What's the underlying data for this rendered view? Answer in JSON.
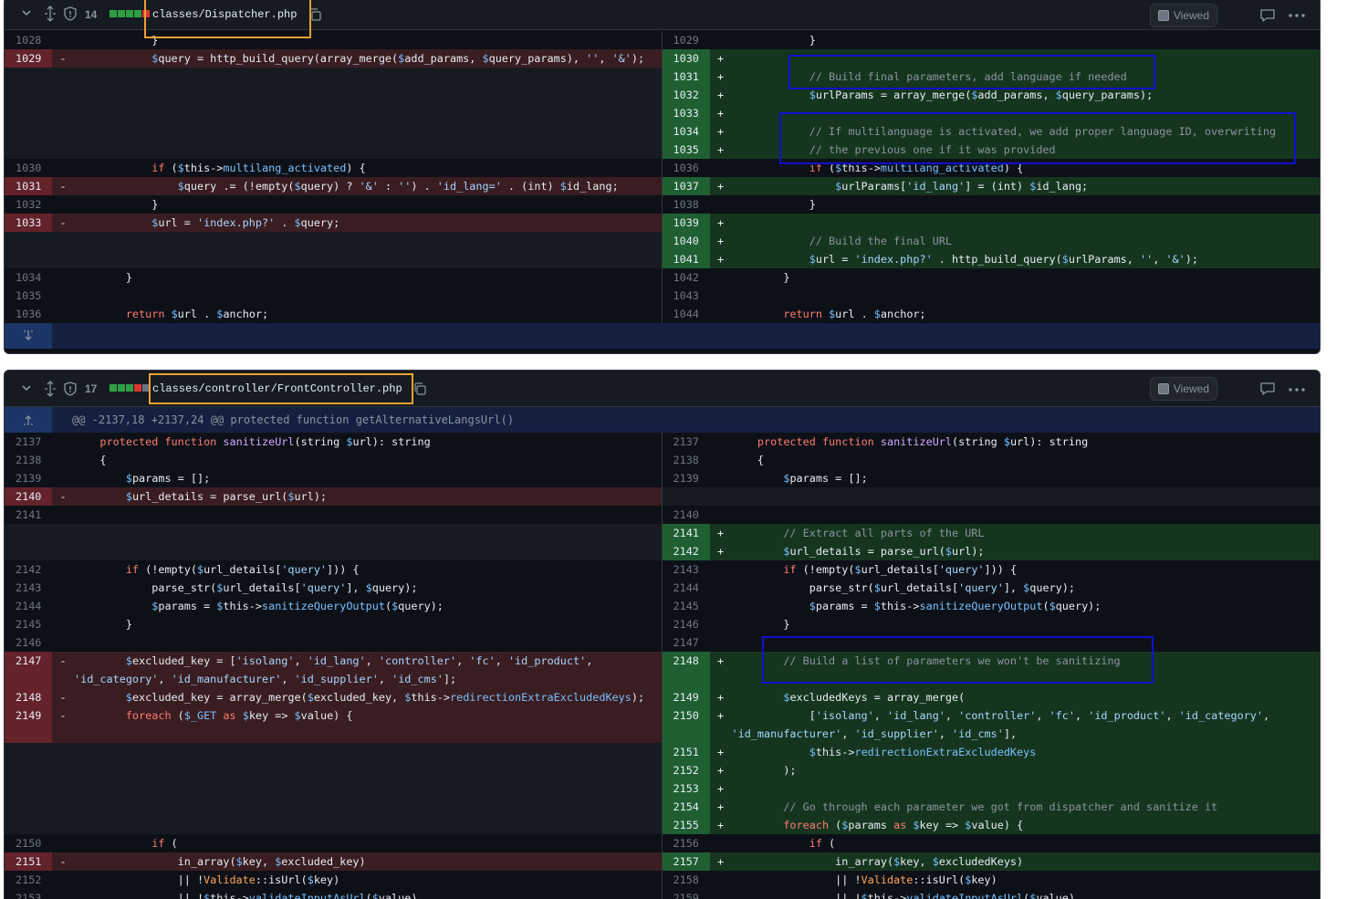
{
  "files": [
    {
      "name": "classes/Dispatcher.php",
      "changes": "14",
      "viewed_label": "Viewed",
      "stat_colors": [
        "#2ea043",
        "#2ea043",
        "#2ea043",
        "#2ea043",
        "#da3633",
        "#6e7681"
      ]
    },
    {
      "name": "classes/controller/FrontController.php",
      "changes": "17",
      "viewed_label": "Viewed",
      "hunk": "@@ -2137,18 +2137,24 @@ protected function getAlternativeLangsUrl()",
      "stat_colors": [
        "#2ea043",
        "#2ea043",
        "#2ea043",
        "#da3633",
        "#da3633",
        "#6e7681"
      ]
    }
  ],
  "diff1": [
    {
      "l": {
        "n": "1028",
        "k": "ctx",
        "c": "            }"
      },
      "r": {
        "n": "1029",
        "k": "ctx",
        "c": "            }"
      }
    },
    {
      "l": {
        "n": "1029",
        "k": "del",
        "c": "            $query = http_build_query(array_merge($add_params, $query_params), '', '&');"
      },
      "r": {
        "n": "1030",
        "k": "add",
        "c": ""
      }
    },
    {
      "l": {
        "k": "empty"
      },
      "r": {
        "n": "1031",
        "k": "add",
        "c": "            // Build final parameters, add language if needed"
      }
    },
    {
      "l": {
        "k": "empty"
      },
      "r": {
        "n": "1032",
        "k": "add",
        "c": "            $urlParams = array_merge($add_params, $query_params);"
      }
    },
    {
      "l": {
        "k": "empty"
      },
      "r": {
        "n": "1033",
        "k": "add",
        "c": ""
      }
    },
    {
      "l": {
        "k": "empty"
      },
      "r": {
        "n": "1034",
        "k": "add",
        "c": "            // If multilanguage is activated, we add proper language ID, overwriting"
      }
    },
    {
      "l": {
        "k": "empty"
      },
      "r": {
        "n": "1035",
        "k": "add",
        "c": "            // the previous one if it was provided"
      }
    },
    {
      "l": {
        "n": "1030",
        "k": "ctx",
        "c": "            if ($this->multilang_activated) {"
      },
      "r": {
        "n": "1036",
        "k": "ctx",
        "c": "            if ($this->multilang_activated) {"
      }
    },
    {
      "l": {
        "n": "1031",
        "k": "del",
        "c": "                $query .= (!empty($query) ? '&' : '') . 'id_lang=' . (int) $id_lang;"
      },
      "r": {
        "n": "1037",
        "k": "add",
        "c": "                $urlParams['id_lang'] = (int) $id_lang;"
      }
    },
    {
      "l": {
        "n": "1032",
        "k": "ctx",
        "c": "            }"
      },
      "r": {
        "n": "1038",
        "k": "ctx",
        "c": "            }"
      }
    },
    {
      "l": {
        "n": "1033",
        "k": "del",
        "c": "            $url = 'index.php?' . $query;"
      },
      "r": {
        "n": "1039",
        "k": "add",
        "c": ""
      }
    },
    {
      "l": {
        "k": "empty"
      },
      "r": {
        "n": "1040",
        "k": "add",
        "c": "            // Build the final URL"
      }
    },
    {
      "l": {
        "k": "empty"
      },
      "r": {
        "n": "1041",
        "k": "add",
        "c": "            $url = 'index.php?' . http_build_query($urlParams, '', '&');"
      }
    },
    {
      "l": {
        "n": "1034",
        "k": "ctx",
        "c": "        }"
      },
      "r": {
        "n": "1042",
        "k": "ctx",
        "c": "        }"
      }
    },
    {
      "l": {
        "n": "1035",
        "k": "ctx",
        "c": ""
      },
      "r": {
        "n": "1043",
        "k": "ctx",
        "c": ""
      }
    },
    {
      "l": {
        "n": "1036",
        "k": "ctx",
        "c": "        return $url . $anchor;"
      },
      "r": {
        "n": "1044",
        "k": "ctx",
        "c": "        return $url . $anchor;"
      }
    }
  ],
  "diff2": [
    {
      "l": {
        "n": "2137",
        "k": "ctx",
        "c": "    protected function sanitizeUrl(string $url): string"
      },
      "r": {
        "n": "2137",
        "k": "ctx",
        "c": "    protected function sanitizeUrl(string $url): string"
      }
    },
    {
      "l": {
        "n": "2138",
        "k": "ctx",
        "c": "    {"
      },
      "r": {
        "n": "2138",
        "k": "ctx",
        "c": "    {"
      }
    },
    {
      "l": {
        "n": "2139",
        "k": "ctx",
        "c": "        $params = [];"
      },
      "r": {
        "n": "2139",
        "k": "ctx",
        "c": "        $params = [];"
      }
    },
    {
      "l": {
        "n": "2140",
        "k": "del",
        "c": "        $url_details = parse_url($url);"
      },
      "r": {
        "k": "empty"
      }
    },
    {
      "l": {
        "n": "2141",
        "k": "ctx",
        "c": ""
      },
      "r": {
        "n": "2140",
        "k": "ctx",
        "c": ""
      }
    },
    {
      "l": {
        "k": "empty"
      },
      "r": {
        "n": "2141",
        "k": "add",
        "c": "        // Extract all parts of the URL"
      }
    },
    {
      "l": {
        "k": "empty"
      },
      "r": {
        "n": "2142",
        "k": "add",
        "c": "        $url_details = parse_url($url);"
      }
    },
    {
      "l": {
        "n": "2142",
        "k": "ctx",
        "c": "        if (!empty($url_details['query'])) {"
      },
      "r": {
        "n": "2143",
        "k": "ctx",
        "c": "        if (!empty($url_details['query'])) {"
      }
    },
    {
      "l": {
        "n": "2143",
        "k": "ctx",
        "c": "            parse_str($url_details['query'], $query);"
      },
      "r": {
        "n": "2144",
        "k": "ctx",
        "c": "            parse_str($url_details['query'], $query);"
      }
    },
    {
      "l": {
        "n": "2144",
        "k": "ctx",
        "c": "            $params = $this->sanitizeQueryOutput($query);"
      },
      "r": {
        "n": "2145",
        "k": "ctx",
        "c": "            $params = $this->sanitizeQueryOutput($query);"
      }
    },
    {
      "l": {
        "n": "2145",
        "k": "ctx",
        "c": "        }"
      },
      "r": {
        "n": "2146",
        "k": "ctx",
        "c": "        }"
      }
    },
    {
      "l": {
        "n": "2146",
        "k": "ctx",
        "c": ""
      },
      "r": {
        "n": "2147",
        "k": "ctx",
        "c": ""
      }
    },
    {
      "l": {
        "n": "2147",
        "k": "del",
        "c": "        $excluded_key = ['isolang', 'id_lang', 'controller', 'fc', 'id_product',"
      },
      "r": {
        "n": "2148",
        "k": "add",
        "c": "        // Build a list of parameters we won't be sanitizing"
      }
    },
    {
      "l": {
        "k": "del",
        "c": "'id_category', 'id_manufacturer', 'id_supplier', 'id_cms'];"
      },
      "r": {
        "k": "add",
        "c": ""
      }
    },
    {
      "l": {
        "n": "2148",
        "k": "del",
        "c": "        $excluded_key = array_merge($excluded_key, $this->redirectionExtraExcludedKeys);"
      },
      "r": {
        "n": "2149",
        "k": "add",
        "c": "        $excludedKeys = array_merge("
      }
    },
    {
      "l": {
        "n": "2149",
        "k": "del",
        "c": "        foreach ($_GET as $key => $value) {"
      },
      "r": {
        "n": "2150",
        "k": "add",
        "c": "            ['isolang', 'id_lang', 'controller', 'fc', 'id_product', 'id_category',"
      }
    },
    {
      "l": {
        "k": "del",
        "c": ""
      },
      "r": {
        "k": "add",
        "c": "'id_manufacturer', 'id_supplier', 'id_cms'],"
      }
    },
    {
      "l": {
        "k": "empty"
      },
      "r": {
        "n": "2151",
        "k": "add",
        "c": "            $this->redirectionExtraExcludedKeys"
      }
    },
    {
      "l": {
        "k": "empty"
      },
      "r": {
        "n": "2152",
        "k": "add",
        "c": "        );"
      }
    },
    {
      "l": {
        "k": "empty"
      },
      "r": {
        "n": "2153",
        "k": "add",
        "c": ""
      }
    },
    {
      "l": {
        "k": "empty"
      },
      "r": {
        "n": "2154",
        "k": "add",
        "c": "        // Go through each parameter we got from dispatcher and sanitize it"
      }
    },
    {
      "l": {
        "k": "empty"
      },
      "r": {
        "n": "2155",
        "k": "add",
        "c": "        foreach ($params as $key => $value) {"
      }
    },
    {
      "l": {
        "n": "2150",
        "k": "ctx",
        "c": "            if ("
      },
      "r": {
        "n": "2156",
        "k": "ctx",
        "c": "            if ("
      }
    },
    {
      "l": {
        "n": "2151",
        "k": "del",
        "c": "                in_array($key, $excluded_key)"
      },
      "r": {
        "n": "2157",
        "k": "add",
        "c": "                in_array($key, $excludedKeys)"
      }
    },
    {
      "l": {
        "n": "2152",
        "k": "ctx",
        "c": "                || !Validate::isUrl($key)"
      },
      "r": {
        "n": "2158",
        "k": "ctx",
        "c": "                || !Validate::isUrl($key)"
      }
    },
    {
      "l": {
        "n": "2153",
        "k": "ctx",
        "c": "                || !$this->validateInputAsUrl($value)"
      },
      "r": {
        "n": "2159",
        "k": "ctx",
        "c": "                || !$this->validateInputAsUrl($value)"
      }
    }
  ],
  "annotation_colors": {
    "orange": "#f0a030",
    "blue": "#1010d0"
  },
  "icons": {
    "collapse": "chevron-down-icon",
    "expand": "unfold-icon",
    "shield": "shield-icon",
    "copy": "copy-icon",
    "comment": "comment-icon",
    "more": "kebab-icon"
  }
}
